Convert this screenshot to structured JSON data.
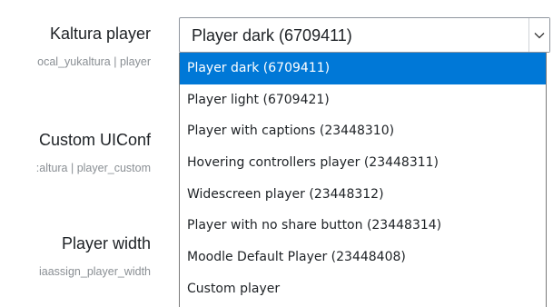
{
  "form": {
    "rows": [
      {
        "title": "Kaltura player",
        "sub": "ocal_yukaltura | player"
      },
      {
        "title": "Custom UIConf",
        "sub": ":altura | player_custom"
      },
      {
        "title": "Player width",
        "sub": "iaassign_player_width"
      }
    ]
  },
  "select": {
    "value": "Player dark (6709411)",
    "arrow_icon": "chevron-down-icon",
    "options": [
      "Player dark (6709411)",
      "Player light (6709421)",
      "Player with captions (23448310)",
      "Hovering controllers player (23448311)",
      "Widescreen player (23448312)",
      "Player with no share button (23448314)",
      "Moodle Default Player (23448408)",
      "Custom player"
    ],
    "selected_index": 0,
    "highlight_color": "#0078d7"
  }
}
